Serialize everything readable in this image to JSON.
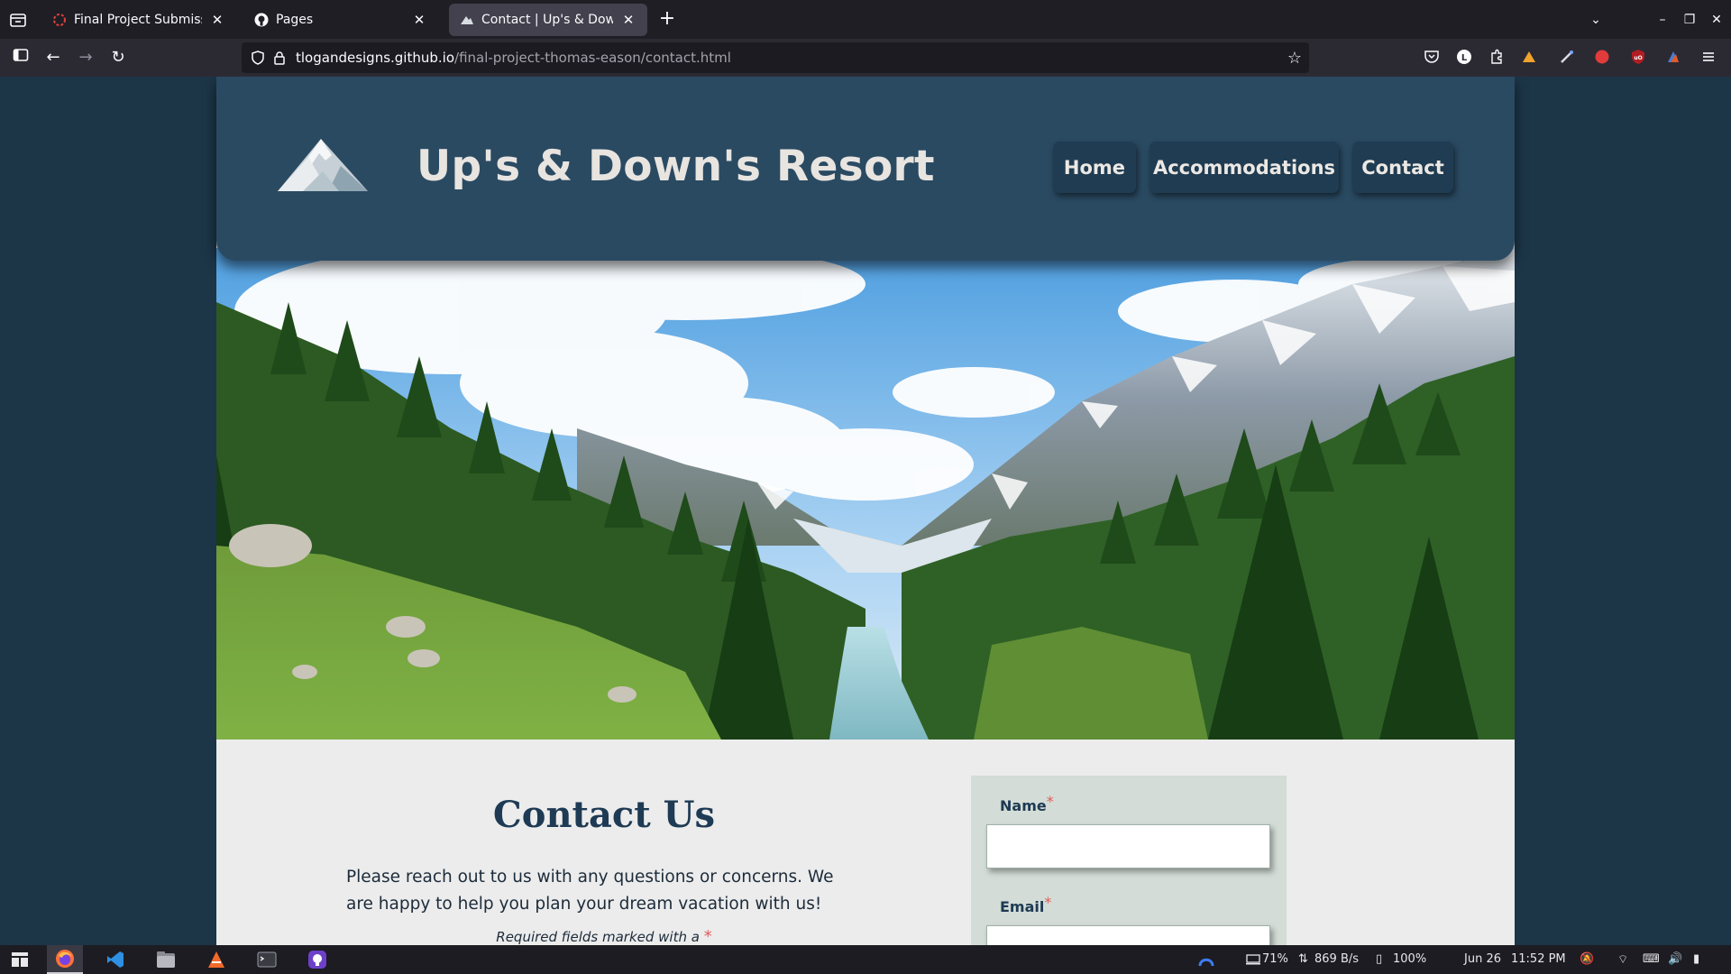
{
  "browser": {
    "tabs": [
      {
        "title": "Final Project Submission",
        "active": false
      },
      {
        "title": "Pages",
        "active": false
      },
      {
        "title": "Contact | Up's & Down's R",
        "active": true
      }
    ],
    "url": {
      "host": "tlogandesigns.github.io",
      "path": "/final-project-thomas-eason/contact.html"
    }
  },
  "site": {
    "title": "Up's & Down's Resort",
    "nav": [
      "Home",
      "Accommodations",
      "Contact"
    ],
    "contact": {
      "heading": "Contact Us",
      "intro": "Please reach out to us with any questions or concerns. We are happy to help you plan your dream vacation with us!",
      "required_note": "Required fields marked with a",
      "required_star": "*"
    },
    "form": {
      "name_label": "Name",
      "email_label": "Email",
      "required_mark": "*"
    }
  },
  "taskbar": {
    "battery": "71%",
    "network": "869 B/s",
    "brightness": "100%",
    "date": "Jun 26",
    "time": "11:52 PM"
  },
  "colors": {
    "header": "#2a4a62",
    "nav_button": "#1f3c52",
    "page_bg": "#1c3547",
    "accent_heading": "#1e3a54",
    "required": "#e05c5c"
  }
}
